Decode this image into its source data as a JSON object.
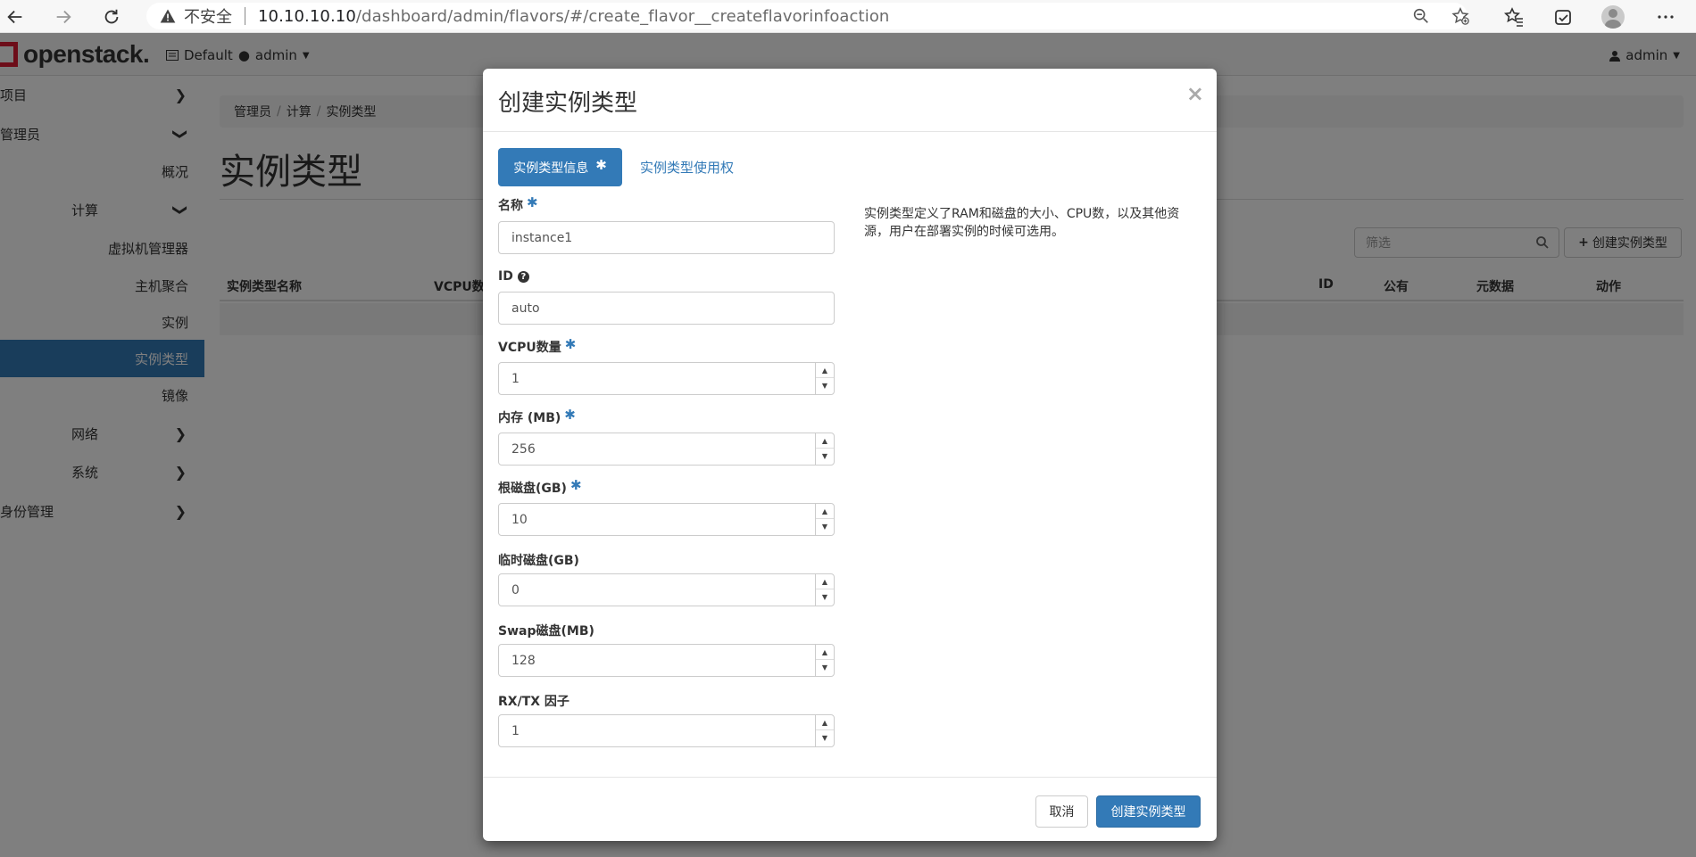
{
  "browser": {
    "security_label": "不安全",
    "url_host": "10.10.10.10",
    "url_path": "/dashboard/admin/flavors/#/create_flavor__createflavorinfoaction"
  },
  "header": {
    "logo_text": "openstack.",
    "project_domain": "Default",
    "project_user": "admin",
    "user_label": "admin"
  },
  "sidebar": {
    "items": [
      {
        "label": "项目"
      },
      {
        "label": "管理员"
      },
      {
        "label": "概况"
      },
      {
        "label": "计算"
      },
      {
        "label": "虚拟机管理器"
      },
      {
        "label": "主机聚合"
      },
      {
        "label": "实例"
      },
      {
        "label": "实例类型"
      },
      {
        "label": "镜像"
      },
      {
        "label": "网络"
      },
      {
        "label": "系统"
      },
      {
        "label": "身份管理"
      }
    ],
    "active_index": 7
  },
  "breadcrumb": [
    "管理员",
    "计算",
    "实例类型"
  ],
  "page_title": "实例类型",
  "toolbar": {
    "filter_placeholder": "筛选",
    "create_label": "创建实例类型"
  },
  "table": {
    "columns": [
      "实例类型名称",
      "VCPU数",
      "ID",
      "公有",
      "元数据",
      "动作"
    ]
  },
  "modal": {
    "title": "创建实例类型",
    "close_glyph": "×",
    "tab_active": "实例类型信息",
    "tab_other": "实例类型使用权",
    "required_mark": "✱",
    "description": "实例类型定义了RAM和磁盘的大小、CPU数，以及其他资源，用户在部署实例的时候可选用。",
    "fields": {
      "name": {
        "label": "名称",
        "value": "instance1"
      },
      "id": {
        "label": "ID",
        "value": "auto"
      },
      "vcpu": {
        "label": "VCPU数量",
        "value": "1"
      },
      "ram": {
        "label": "内存 (MB)",
        "value": "256"
      },
      "root_disk": {
        "label": "根磁盘(GB)",
        "value": "10"
      },
      "ephemeral": {
        "label": "临时磁盘(GB)",
        "value": "0"
      },
      "swap": {
        "label": "Swap磁盘(MB)",
        "value": "128"
      },
      "rxtx": {
        "label": "RX/TX 因子",
        "value": "1"
      }
    },
    "cancel_label": "取消",
    "submit_label": "创建实例类型"
  },
  "colors": {
    "primary": "#337ab7",
    "brand_red": "#da1a32"
  }
}
